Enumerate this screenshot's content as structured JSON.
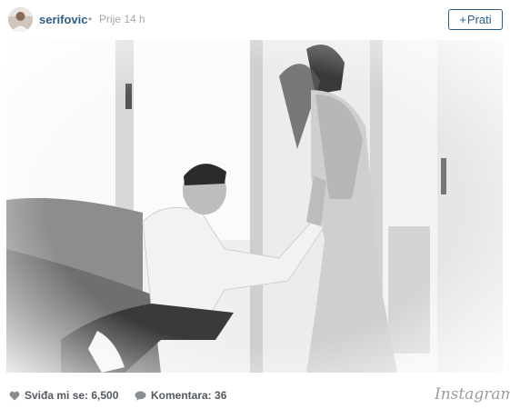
{
  "post": {
    "username": "serifovic",
    "separator": "•",
    "time": "Prije 14 h",
    "follow_label": "Prati",
    "follow_icon": "plus-icon"
  },
  "footer": {
    "likes_label": "Sviđa mi se: 6,500",
    "comments_label": "Komentara: 36",
    "brand": "Instagram",
    "like_icon": "heart-icon",
    "comment_icon": "speech-bubble-icon"
  },
  "colors": {
    "link_blue": "#2e5e86",
    "muted_gray": "#a5a7aa",
    "footer_text": "#555a5f"
  }
}
